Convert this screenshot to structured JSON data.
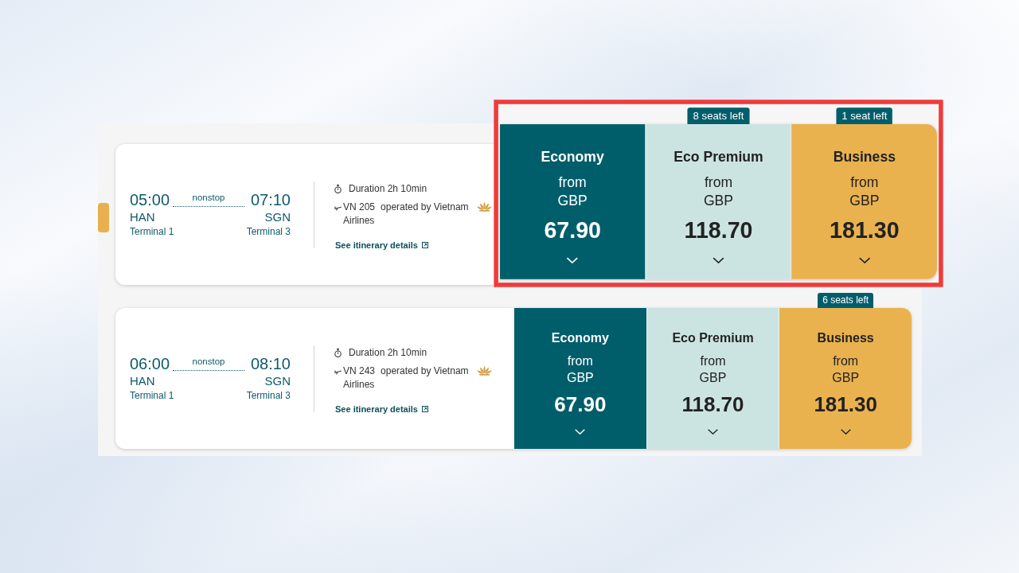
{
  "flights": [
    {
      "selected": true,
      "highlighted": true,
      "departure": {
        "time": "05:00",
        "airport": "HAN",
        "terminal": "Terminal 1"
      },
      "stops": "nonstop",
      "arrival": {
        "time": "07:10",
        "airport": "SGN",
        "terminal": "Terminal 3"
      },
      "duration": "Duration 2h 10min",
      "flight_number": "VN 205",
      "operator": "operated by Vietnam Airlines",
      "details_link": "See itinerary details",
      "fares": [
        {
          "kind": "economy",
          "cabin": "Economy",
          "from": "from",
          "currency": "GBP",
          "price": "67.90"
        },
        {
          "kind": "eco_premium",
          "cabin": "Eco Premium",
          "from": "from",
          "currency": "GBP",
          "price": "118.70",
          "seats_left": "8 seats left"
        },
        {
          "kind": "business",
          "cabin": "Business",
          "from": "from",
          "currency": "GBP",
          "price": "181.30",
          "seats_left": "1 seat left"
        }
      ]
    },
    {
      "selected": false,
      "highlighted": false,
      "departure": {
        "time": "06:00",
        "airport": "HAN",
        "terminal": "Terminal 1"
      },
      "stops": "nonstop",
      "arrival": {
        "time": "08:10",
        "airport": "SGN",
        "terminal": "Terminal 3"
      },
      "duration": "Duration 2h 10min",
      "flight_number": "VN 243",
      "operator": "operated by Vietnam Airlines",
      "details_link": "See itinerary details",
      "fares": [
        {
          "kind": "economy",
          "cabin": "Economy",
          "from": "from",
          "currency": "GBP",
          "price": "67.90"
        },
        {
          "kind": "eco_premium",
          "cabin": "Eco Premium",
          "from": "from",
          "currency": "GBP",
          "price": "118.70"
        },
        {
          "kind": "business",
          "cabin": "Business",
          "from": "from",
          "currency": "GBP",
          "price": "181.30",
          "seats_left": "6 seats left"
        }
      ]
    }
  ]
}
